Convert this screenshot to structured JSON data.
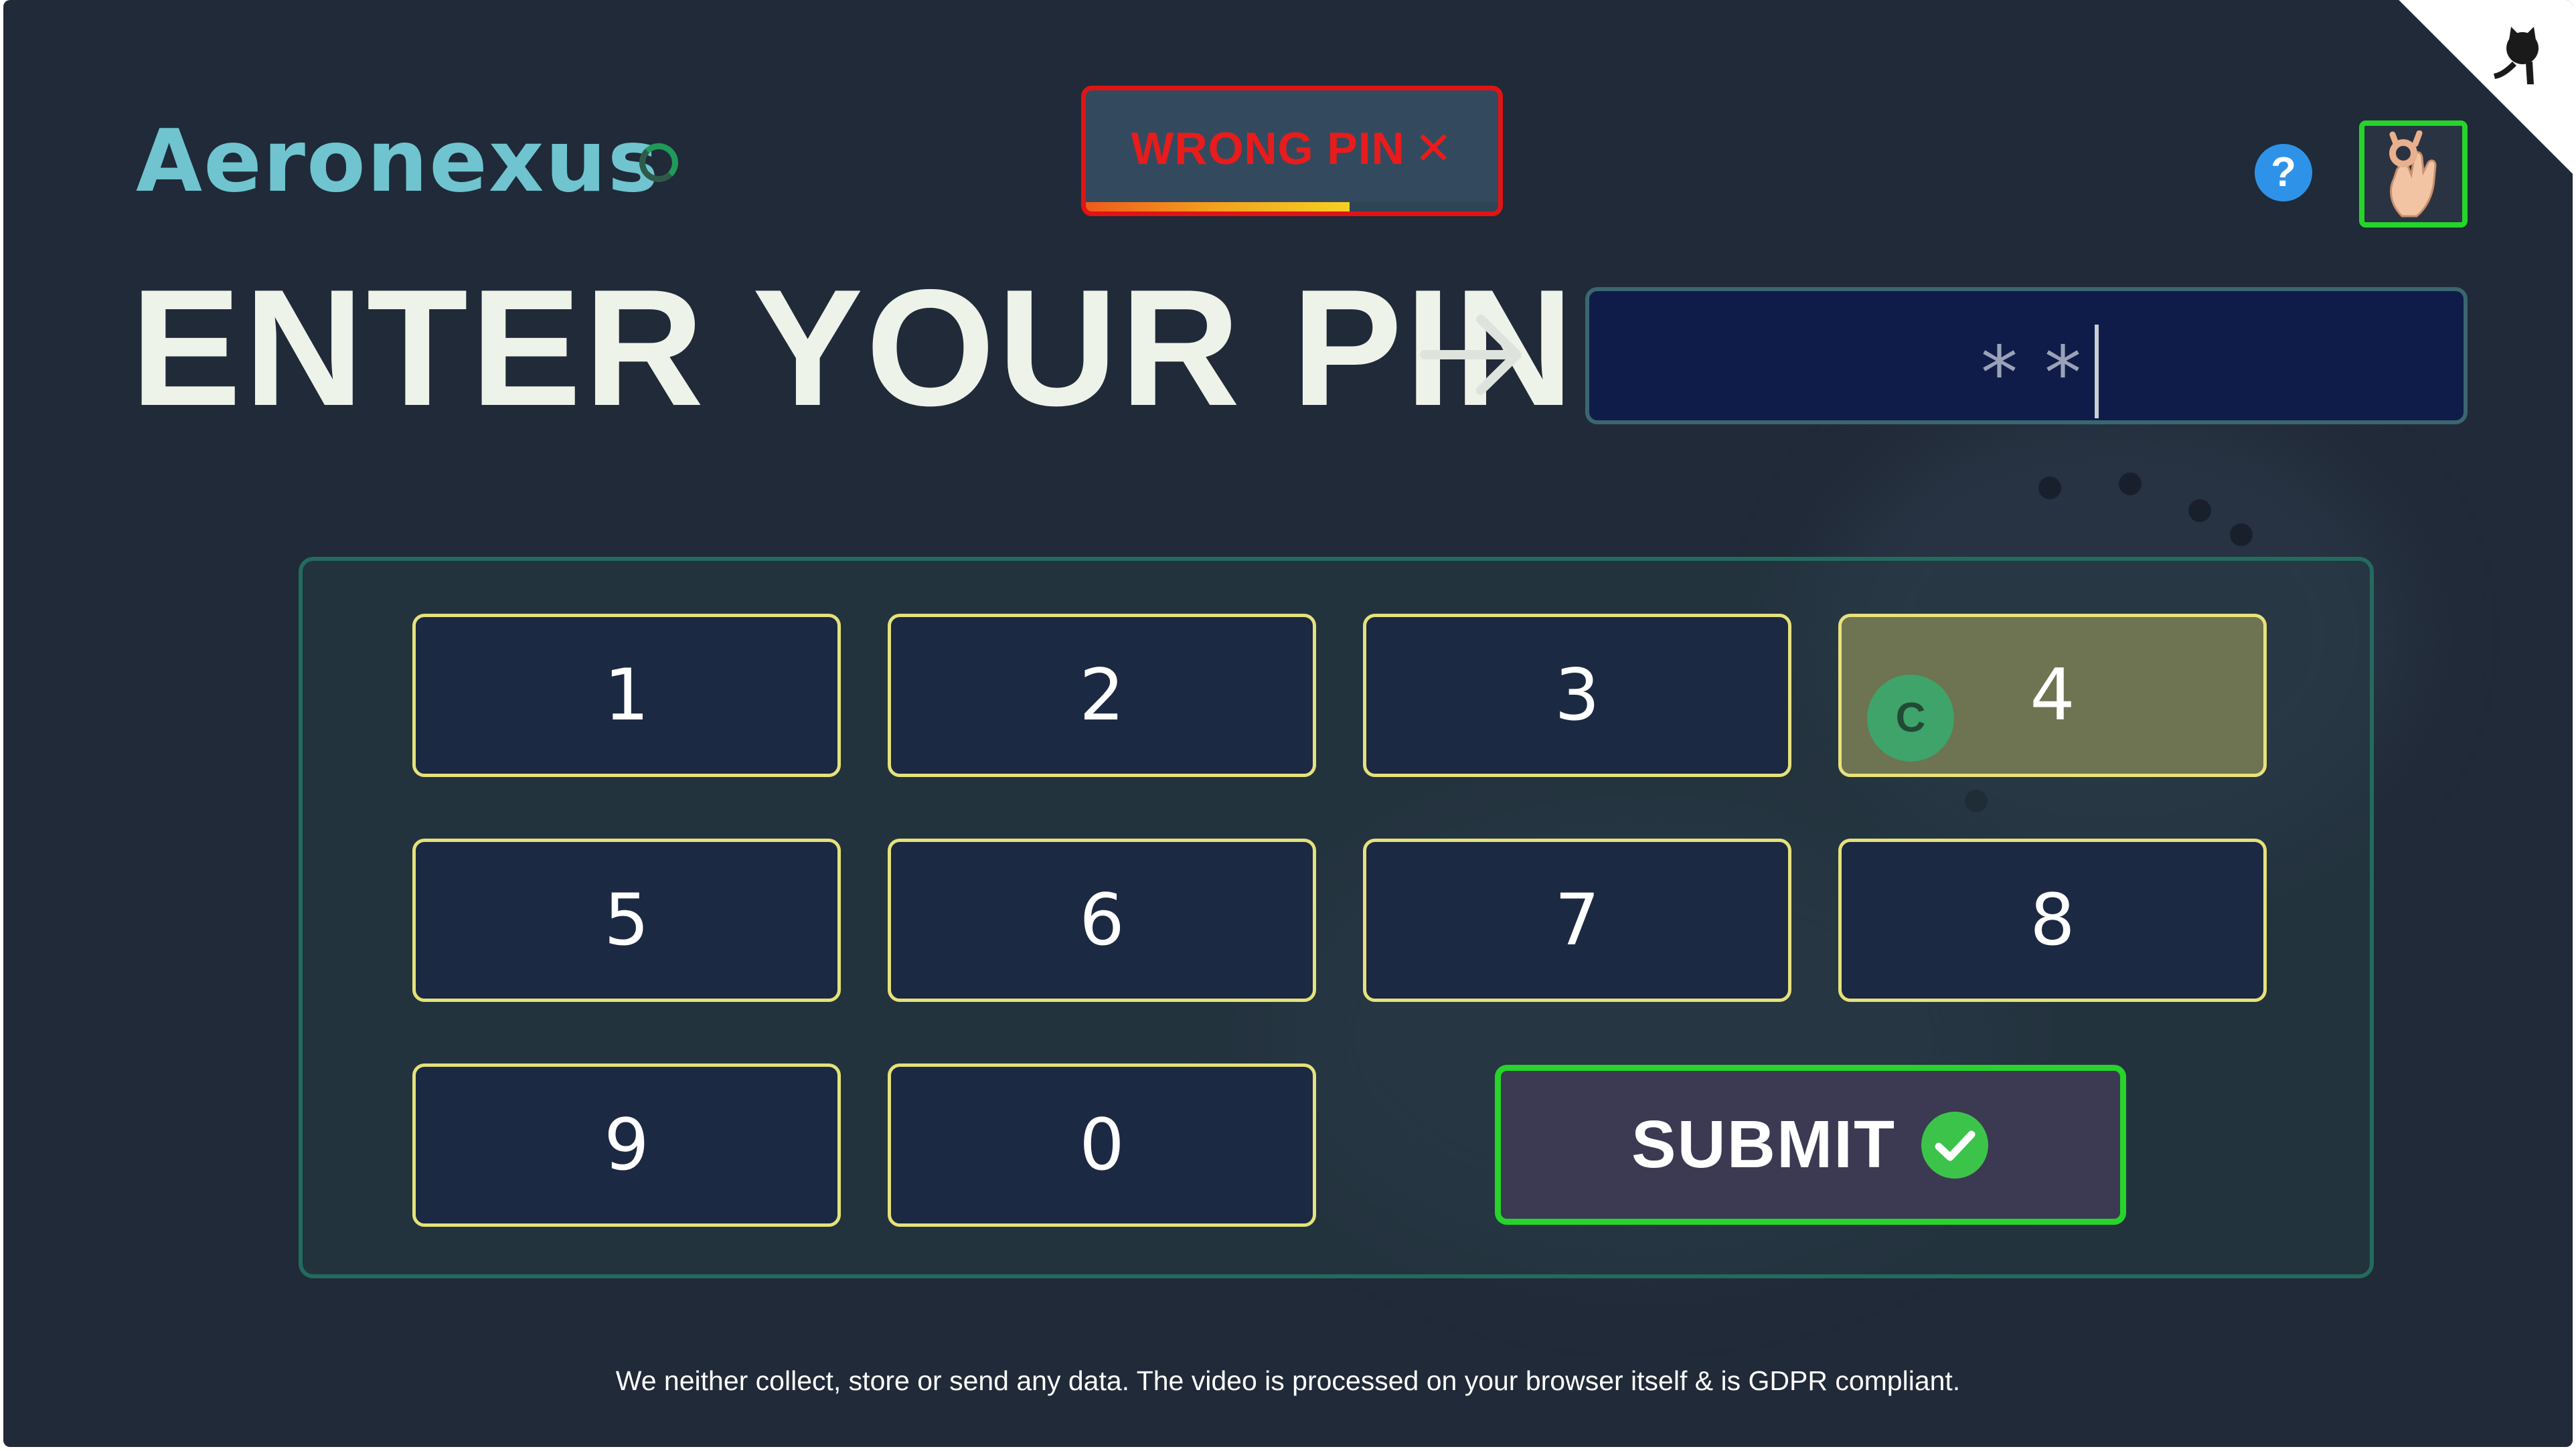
{
  "header": {
    "logo_text": "Aeronexus",
    "alert_text": "WRONG PIN",
    "alert_icon": "close-icon",
    "alert_progress": 0.64,
    "help_label": "?",
    "gesture_icon": "ok-hand-icon",
    "corner_icon": "github-octocat-icon"
  },
  "pin": {
    "title": "ENTER YOUR PIN",
    "arrow_icon": "arrow-right-icon",
    "value": "**"
  },
  "keypad": {
    "keys": [
      "1",
      "2",
      "3",
      "4",
      "5",
      "6",
      "7",
      "8",
      "9",
      "0"
    ],
    "highlighted_key": "4",
    "cursor_label": "C",
    "submit_label": "SUBMIT",
    "submit_icon": "check-circle-icon"
  },
  "footer": {
    "text": "We neither collect, store or send any data. The video is processed on your browser itself & is GDPR compliant."
  },
  "colors": {
    "background": "#202a38",
    "accent_green": "#26d42a",
    "error_red": "#e01414",
    "key_border": "#e6e27a",
    "logo": "#6fc4cf"
  }
}
